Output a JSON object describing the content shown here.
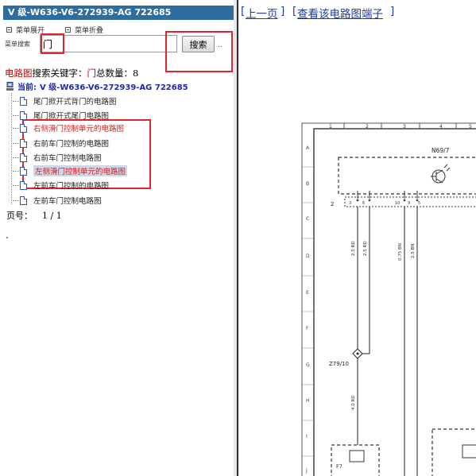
{
  "title_bar": "V 级-W636-V6-272939-AG 722685",
  "menu": {
    "expand_label": "菜单展开",
    "collapse_label": "菜单折叠"
  },
  "search": {
    "label": "菜单搜索",
    "value": "门",
    "button_label": "搜索",
    "more_label": ".."
  },
  "summary": {
    "category": "电路图",
    "keyword_label": "搜索关键字：",
    "keyword": "门",
    "total_label": "总数量：",
    "total": "8"
  },
  "current": {
    "prefix": "当前:",
    "model": "V 级-W636-V6-272939-AG 722685"
  },
  "tree_items": [
    {
      "label": "尾门掀开式背门的电路图",
      "state": "normal"
    },
    {
      "label": "尾门掀开式尾门电路图",
      "state": "normal"
    },
    {
      "label": "右侧滑门控制单元的电路图",
      "state": "red"
    },
    {
      "label": "右前车门控制的电路图",
      "state": "normal"
    },
    {
      "label": "右前车门控制电路图",
      "state": "normal"
    },
    {
      "label": "左侧滑门控制单元的电路图",
      "state": "selected"
    },
    {
      "label": "左前车门控制的电路图",
      "state": "normal"
    },
    {
      "label": "左前车门控制电路图",
      "state": "normal"
    }
  ],
  "pager": {
    "label": "页号：",
    "value": "1 / 1"
  },
  "nav": {
    "prev_label": "上一页",
    "view_terminals_label": "查看该电路图端子"
  },
  "diagram": {
    "column_numbers": [
      "1",
      "2",
      "3",
      "4",
      "5"
    ],
    "row_letters": [
      "A",
      "B",
      "C",
      "D",
      "E",
      "F",
      "G",
      "H",
      "I",
      "J"
    ],
    "component_n69": "N69/7",
    "component_z79": "Z79/10",
    "component_f": "F7",
    "row_label_2": "2",
    "pin_labels": [
      "3",
      "6",
      "10",
      "9",
      "5"
    ],
    "wire_labels": [
      "2.5 RD",
      "2.5 RD",
      "0.75 BN",
      "2.5 BN",
      "4.0 RD"
    ],
    "colors": {
      "highlight": "#e0262c",
      "link": "#1d3aa0",
      "title_bg": "#2e6d9e"
    }
  }
}
